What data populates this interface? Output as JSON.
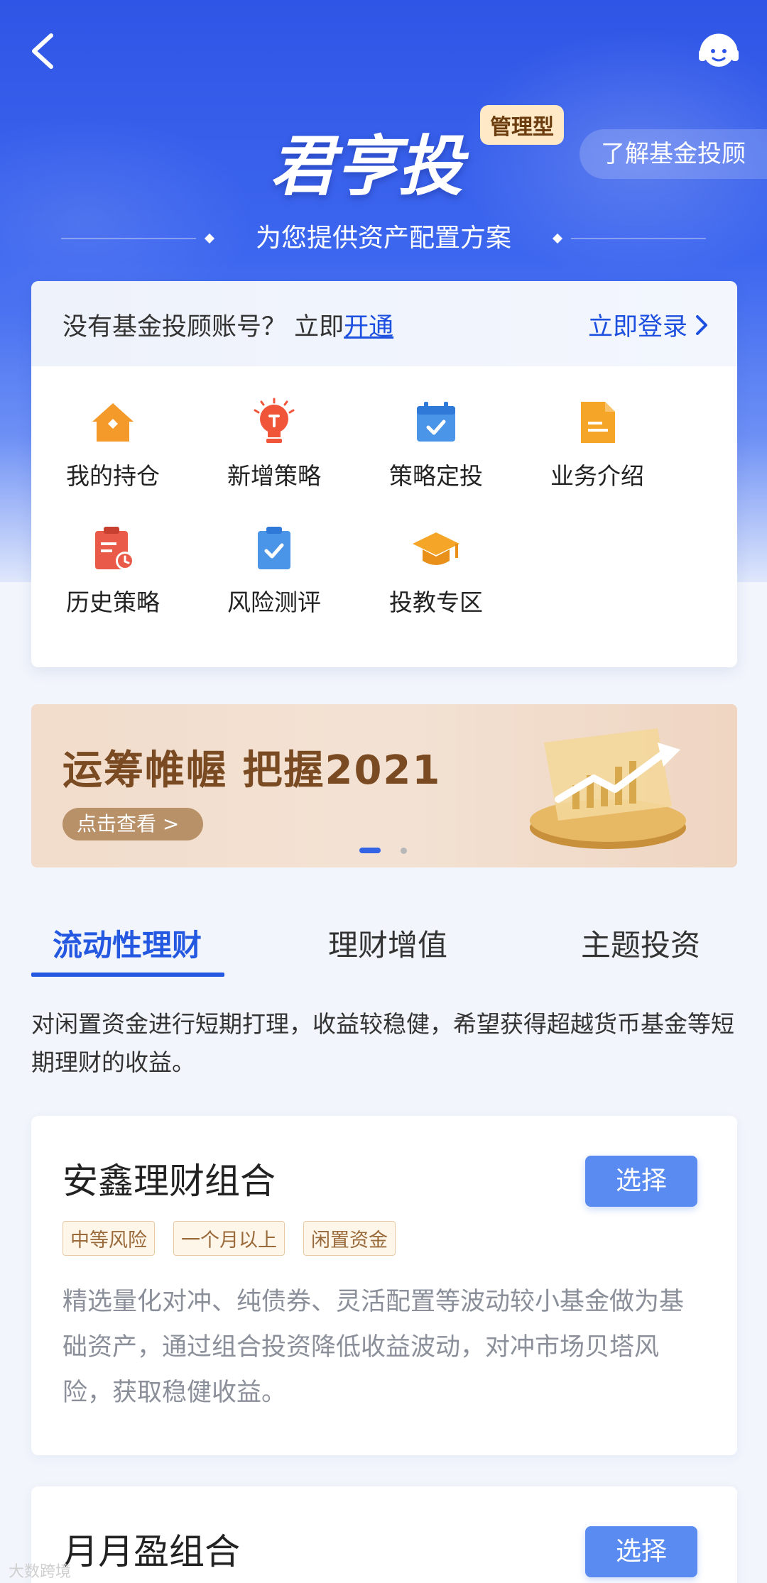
{
  "header": {
    "logo_text": "君亨投",
    "logo_badge": "管理型",
    "learn_more": "了解基金投顾",
    "tagline": "为您提供资产配置方案"
  },
  "account": {
    "prompt": "没有基金投顾账号？ 立即",
    "open_link": "开通",
    "login": "立即登录"
  },
  "functions": [
    {
      "label": "我的持仓",
      "icon": "house-icon"
    },
    {
      "label": "新增策略",
      "icon": "lightbulb-icon"
    },
    {
      "label": "策略定投",
      "icon": "calendar-check-icon"
    },
    {
      "label": "业务介绍",
      "icon": "document-icon"
    },
    {
      "label": "历史策略",
      "icon": "history-clipboard-icon"
    },
    {
      "label": "风险测评",
      "icon": "clipboard-check-icon"
    },
    {
      "label": "投教专区",
      "icon": "graduation-cap-icon"
    }
  ],
  "banner": {
    "title": "运筹帷幄  把握2021",
    "cta": "点击查看 >"
  },
  "tabs": [
    {
      "label": "流动性理财",
      "active": true
    },
    {
      "label": "理财增值",
      "active": false
    },
    {
      "label": "主题投资",
      "active": false
    }
  ],
  "tab_description": "对闲置资金进行短期打理，收益较稳健，希望获得超越货币基金等短期理财的收益。",
  "products": [
    {
      "name": "安鑫理财组合",
      "action": "选择",
      "tags": [
        "中等风险",
        "一个月以上",
        "闲置资金"
      ],
      "description": "精选量化对冲、纯债券、灵活配置等波动较小基金做为基础资产，通过组合投资降低收益波动，对冲市场贝塔风险，获取稳健收益。"
    },
    {
      "name": "月月盈组合",
      "action": "选择"
    }
  ],
  "watermark": "大数跨境",
  "colors": {
    "primary": "#2458e0",
    "hero_top": "#2f55e6",
    "button": "#5a8bf0",
    "tag_text": "#9a6a3a"
  }
}
